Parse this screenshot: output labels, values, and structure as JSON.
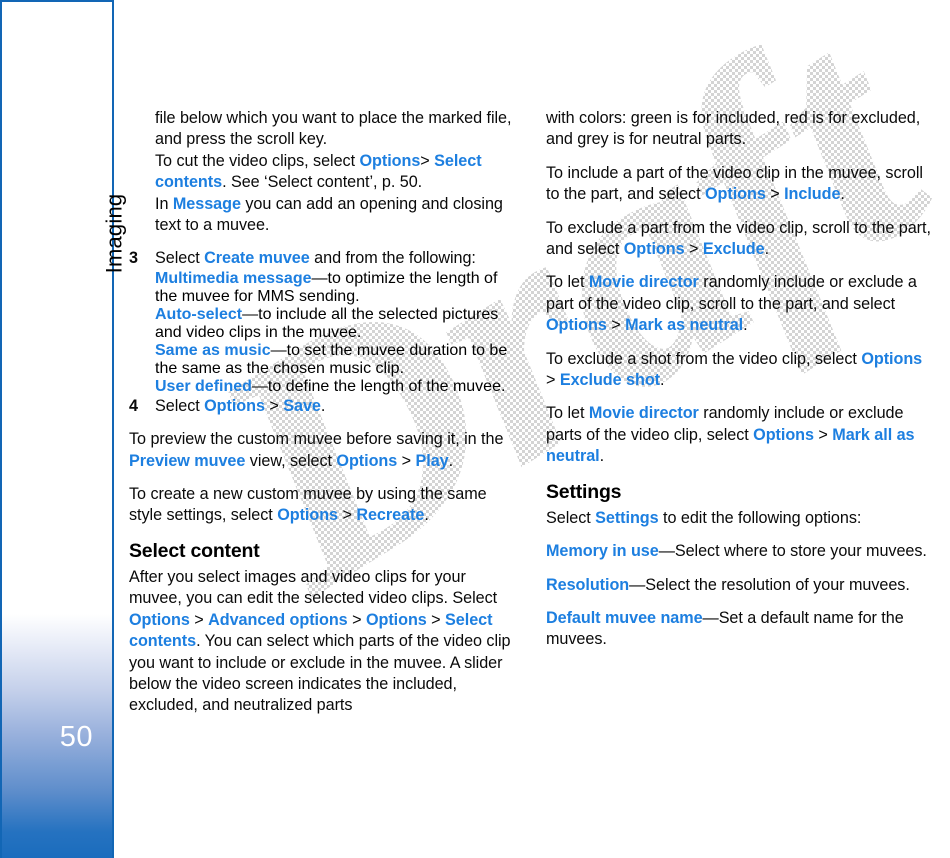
{
  "sidebar": {
    "chapter_label": "Imaging",
    "page_number": "50",
    "border_color": "#1266b5",
    "gradient_end_color": "#1a6cbd"
  },
  "watermark": {
    "text": "Draft",
    "color": "#cfcfcf"
  },
  "colors": {
    "link_blue": "#1d7fe0",
    "body_text": "#0a0a0a"
  },
  "left_column": {
    "step_continuation": {
      "line_1": "file below which you want to place the marked file,",
      "line_2": "and press the scroll key.",
      "line_3_pre": "To cut the video clips, select ",
      "line_3_link_1": "Options",
      "line_3_mid": "> ",
      "line_3_link_2": "Select contents",
      "line_3_post": ". See ‘Select content’, p. 50.",
      "line_4_pre": "In ",
      "line_4_link": "Message",
      "line_4_post": " you can add an opening and closing text to a muvee."
    },
    "step_3": {
      "number": "3",
      "lead_pre": "Select ",
      "lead_link": "Create muvee",
      "lead_post": " and from the following:",
      "options": [
        {
          "term": "Multimedia message",
          "dash": "—",
          "desc": "to optimize the length of the muvee for MMS sending."
        },
        {
          "term": "Auto-select",
          "dash": "—",
          "desc": "to include all the selected pictures and video clips in the muvee."
        },
        {
          "term": "Same as music",
          "dash": "—",
          "desc": "to set the muvee duration to be the same as the chosen music clip."
        },
        {
          "term": "User defined",
          "dash": "—",
          "desc": "to define the length of the muvee."
        }
      ]
    },
    "step_4": {
      "number": "4",
      "pre": "Select ",
      "link_1": "Options",
      "mid": " > ",
      "link_2": "Save",
      "post": "."
    },
    "para_preview": {
      "pre": "To preview the custom muvee before saving it, in the ",
      "link_1": "Preview muvee",
      "mid_1": " view, select ",
      "link_2": "Options",
      "mid_2": " > ",
      "link_3": "Play",
      "post": "."
    },
    "para_recreate": {
      "pre": "To create a new custom muvee by using the same style settings, select ",
      "link_1": "Options",
      "mid_1": " > ",
      "link_2": "Recreate",
      "post": "."
    },
    "heading_select_content": "Select content",
    "para_select_content": {
      "pre": "After you select images and video clips for your muvee, you can edit the selected video clips. Select ",
      "link_1": "Options",
      "mid_1": " > ",
      "link_2": "Advanced options",
      "mid_2": " > ",
      "link_3": "Options",
      "mid_3": " > ",
      "link_4": "Select contents",
      "post": ". You can select which parts of the video clip you want to include or exclude in the muvee. A slider below the video screen indicates the included, excluded, and neutralized parts"
    }
  },
  "right_column": {
    "para_colors": "with colors: green is for included, red is for excluded, and grey is for neutral parts.",
    "para_include": {
      "pre": "To include a part of the video clip in the muvee, scroll to the part, and select ",
      "link_1": "Options",
      "mid_1": " > ",
      "link_2": "Include",
      "post": "."
    },
    "para_exclude": {
      "pre": "To exclude a part from the video clip, scroll to the part, and select ",
      "link_1": "Options",
      "mid_1": " > ",
      "link_2": "Exclude",
      "post": "."
    },
    "para_mark_neutral": {
      "pre": "To let ",
      "link_1": "Movie director",
      "mid_1": " randomly include or exclude a part of the video clip, scroll to the part, and select ",
      "link_2": "Options",
      "mid_2": " > ",
      "link_3": "Mark as neutral",
      "post": "."
    },
    "para_exclude_shot": {
      "pre": "To exclude a shot from the video clip, select ",
      "link_1": "Options",
      "mid_1": " > ",
      "link_2": "Exclude shot",
      "post": "."
    },
    "para_mark_all_neutral": {
      "pre": "To let ",
      "link_1": "Movie director",
      "mid_1": " randomly include or exclude parts of the video clip, select ",
      "link_2": "Options",
      "mid_2": " > ",
      "link_3": "Mark all as neutral",
      "post": "."
    },
    "heading_settings": "Settings",
    "para_settings_intro": {
      "pre": "Select ",
      "link_1": "Settings",
      "post": " to edit the following options:"
    },
    "settings_options": [
      {
        "term": "Memory in use",
        "dash": "—",
        "desc": "Select where to store your muvees."
      },
      {
        "term": "Resolution",
        "dash": "—",
        "desc": "Select the resolution of your muvees."
      },
      {
        "term": "Default muvee name",
        "dash": "—",
        "desc": "Set a default name for the muvees."
      }
    ]
  }
}
